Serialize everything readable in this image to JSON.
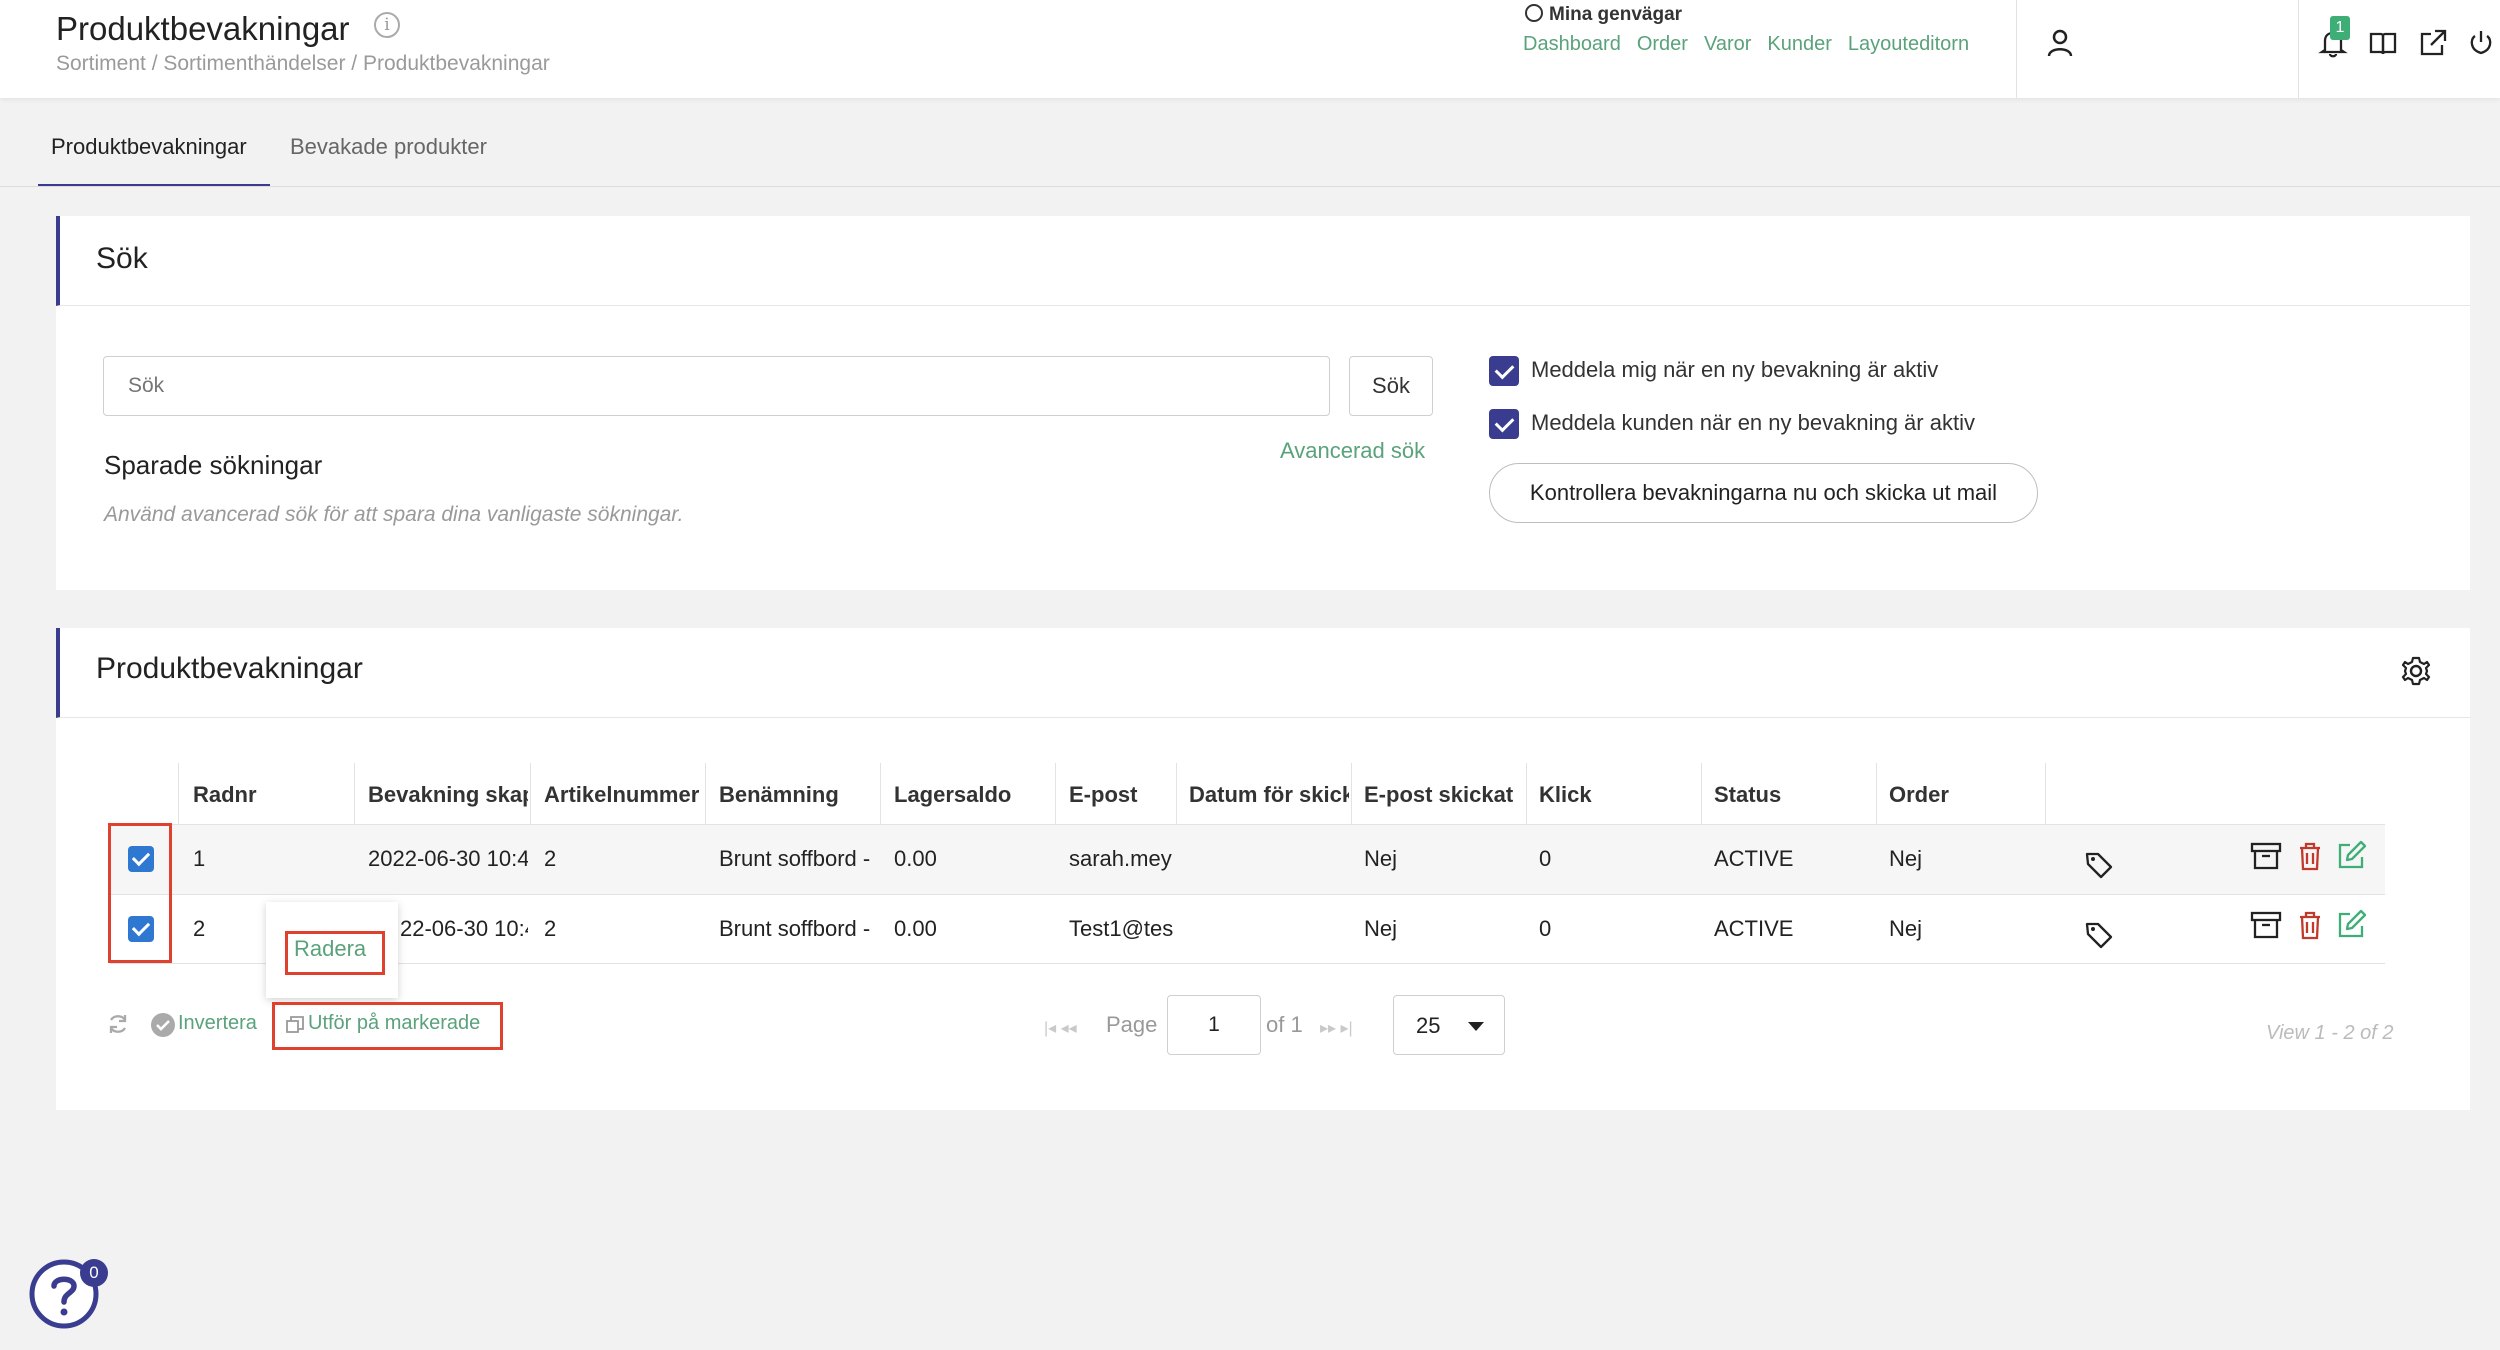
{
  "header": {
    "title": "Produktbevakningar",
    "breadcrumb": "Sortiment / Sortimenthändelser / Produktbevakningar",
    "shortcuts_title": "Mina genvägar",
    "shortcuts": [
      "Dashboard",
      "Order",
      "Varor",
      "Kunder",
      "Layouteditorn"
    ],
    "notification_count": "1"
  },
  "tabs": [
    "Produktbevakningar",
    "Bevakade produkter"
  ],
  "search": {
    "title": "Sök",
    "placeholder": "Sök",
    "button": "Sök",
    "advanced": "Avancerad sök",
    "saved_title": "Sparade sökningar",
    "saved_hint": "Använd avancerad sök för att spara dina vanligaste sökningar.",
    "option1": "Meddela mig när en ny bevakning är aktiv",
    "option2": "Meddela kunden när en ny bevakning är aktiv",
    "control_button": "Kontrollera bevakningarna nu och skicka ut mail"
  },
  "table": {
    "title": "Produktbevakningar",
    "columns": [
      "Radnr",
      "Bevakning skapad",
      "Artikelnummer",
      "Benämning",
      "Lagersaldo",
      "E-post",
      "Datum för skickat",
      "E-post skickat",
      "Klick",
      "Status",
      "Order"
    ],
    "rows": [
      {
        "radnr": "1",
        "created": "2022-06-30 10:4",
        "article": "2",
        "name": "Brunt soffbord -",
        "stock": "0.00",
        "email": "sarah.mey",
        "sent_date": "",
        "email_sent": "Nej",
        "clicks": "0",
        "status": "ACTIVE",
        "order": "Nej"
      },
      {
        "radnr": "2",
        "created": "22-06-30 10:4",
        "article": "2",
        "name": "Brunt soffbord -",
        "stock": "0.00",
        "email": "Test1@tes",
        "sent_date": "",
        "email_sent": "Nej",
        "clicks": "0",
        "status": "ACTIVE",
        "order": "Nej"
      }
    ],
    "popup_item": "Radera"
  },
  "footer": {
    "invert": "Invertera",
    "apply": "Utför på markerade",
    "page_label": "Page",
    "page_value": "1",
    "of_label": "of 1",
    "per_page": "25",
    "view_info": "View 1 - 2 of 2"
  },
  "help_badge": "0",
  "colors": {
    "accent": "#3a3d8f",
    "link": "#5aa27b",
    "highlight": "#e0402e",
    "checkbox": "#2f78d2"
  }
}
